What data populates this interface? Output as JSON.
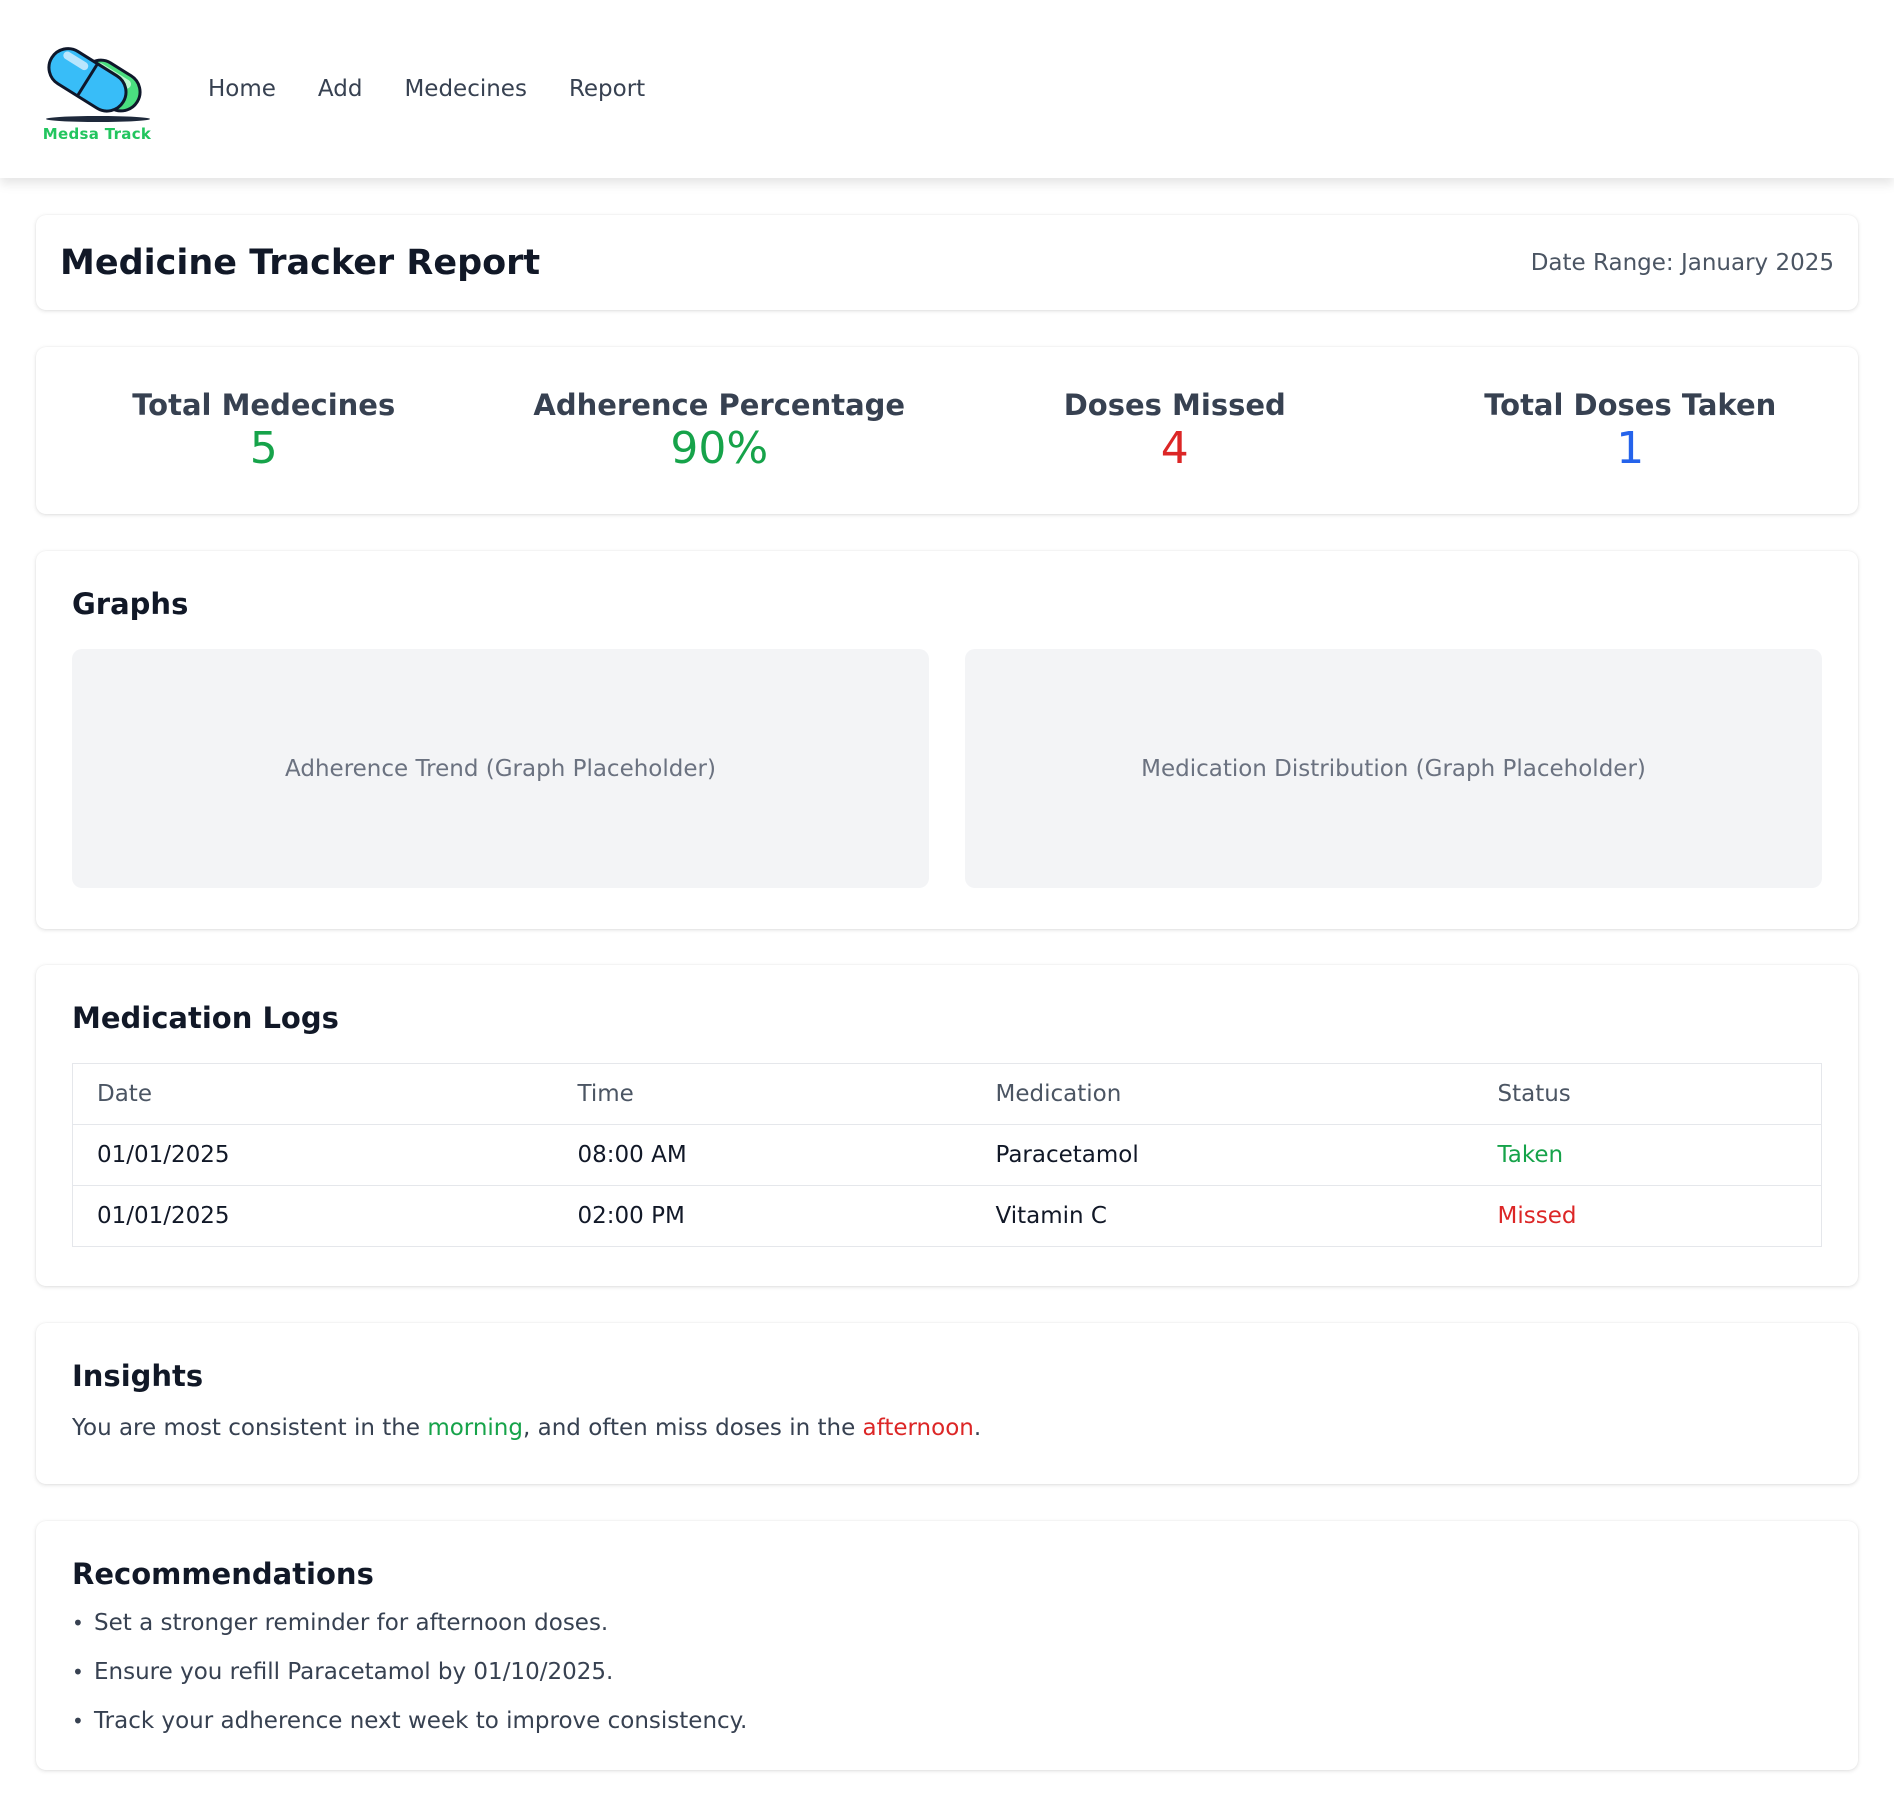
{
  "brand": {
    "name": "Medsa Track",
    "colors": {
      "capsule_blue": "#38bdf8",
      "capsule_green": "#4ade80",
      "text_green": "#22c55e"
    }
  },
  "nav": {
    "items": [
      {
        "label": "Home"
      },
      {
        "label": "Add"
      },
      {
        "label": "Medecines"
      },
      {
        "label": "Report"
      }
    ]
  },
  "header": {
    "title": "Medicine Tracker Report",
    "date_range": "Date Range: January 2025"
  },
  "stats": [
    {
      "label": "Total Medecines",
      "value": "5",
      "color": "#16a34a"
    },
    {
      "label": "Adherence Percentage",
      "value": "90%",
      "color": "#16a34a"
    },
    {
      "label": "Doses Missed",
      "value": "4",
      "color": "#dc2626"
    },
    {
      "label": "Total Doses Taken",
      "value": "1",
      "color": "#2563eb"
    }
  ],
  "graphs": {
    "title": "Graphs",
    "placeholders": [
      "Adherence Trend (Graph Placeholder)",
      "Medication Distribution (Graph Placeholder)"
    ]
  },
  "logs": {
    "title": "Medication Logs",
    "columns": [
      "Date",
      "Time",
      "Medication",
      "Status"
    ],
    "rows": [
      {
        "date": "01/01/2025",
        "time": "08:00 AM",
        "medication": "Paracetamol",
        "status": "Taken",
        "status_color": "#16a34a"
      },
      {
        "date": "01/01/2025",
        "time": "02:00 PM",
        "medication": "Vitamin C",
        "status": "Missed",
        "status_color": "#dc2626"
      }
    ]
  },
  "insights": {
    "title": "Insights",
    "text_1": "You are most consistent in the ",
    "highlight_1": "morning",
    "highlight_1_color": "#16a34a",
    "text_2": ", and often miss doses in the ",
    "highlight_2": "afternoon",
    "highlight_2_color": "#dc2626",
    "text_3": "."
  },
  "recommendations": {
    "title": "Recommendations",
    "items": [
      "Set a stronger reminder for afternoon doses.",
      "Ensure you refill Paracetamol by 01/10/2025.",
      "Track your adherence next week to improve consistency."
    ]
  }
}
